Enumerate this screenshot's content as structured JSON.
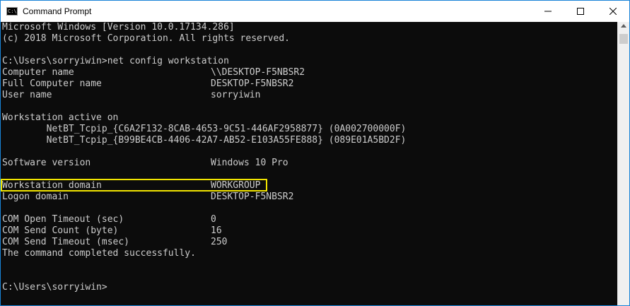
{
  "window": {
    "title": "Command Prompt",
    "icon": "cmd-icon"
  },
  "controls": {
    "minimize_icon": "minimize-icon",
    "maximize_icon": "maximize-icon",
    "close_icon": "close-icon"
  },
  "console": {
    "lines": [
      "Microsoft Windows [Version 10.0.17134.286]",
      "(c) 2018 Microsoft Corporation. All rights reserved.",
      "",
      "C:\\Users\\sorryiwin>net config workstation",
      "Computer name",
      "Full Computer name",
      "User name",
      "",
      "Workstation active on",
      "        NetBT_Tcpip_{C6A2F132-8CAB-4653-9C51-446AF2958877} (0A002700000F)",
      "        NetBT_Tcpip_{B99BE4CB-4406-42A7-AB52-E103A55FE888} (089E01A5BD2F)",
      "",
      "Software version",
      "",
      "Workstation domain",
      "Logon domain",
      "",
      "COM Open Timeout (sec)",
      "COM Send Count (byte)",
      "COM Send Timeout (msec)",
      "The command completed successfully.",
      "",
      "",
      "C:\\Users\\sorryiwin>"
    ],
    "values": {
      "computer_name": "\\\\DESKTOP-F5NBSR2",
      "full_computer_name": "DESKTOP-F5NBSR2",
      "user_name": "sorryiwin",
      "software_version": "Windows 10 Pro",
      "workstation_domain": "WORKGROUP",
      "logon_domain": "DESKTOP-F5NBSR2",
      "com_open_timeout": "0",
      "com_send_count": "16",
      "com_send_timeout": "250"
    }
  },
  "colors": {
    "console_bg": "#0c0c0c",
    "console_fg": "#cccccc",
    "highlight": "#f2e500",
    "window_border": "#1883d7"
  }
}
